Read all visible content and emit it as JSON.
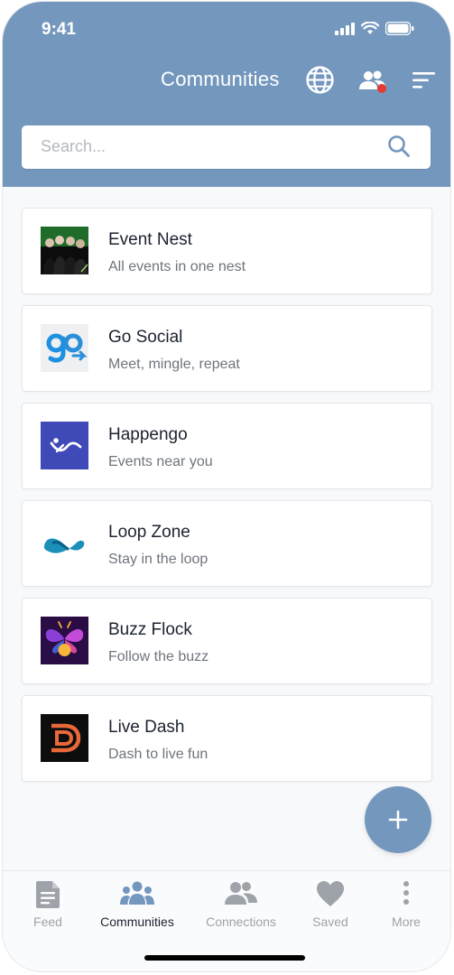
{
  "status": {
    "time": "9:41"
  },
  "header": {
    "title": "Communities"
  },
  "search": {
    "placeholder": "Search..."
  },
  "communities": [
    {
      "title": "Event Nest",
      "subtitle": "All events in one nest",
      "logo": "band-photo-logo"
    },
    {
      "title": "Go Social",
      "subtitle": "Meet, mingle, repeat",
      "logo": "go-logo"
    },
    {
      "title": "Happengo",
      "subtitle": "Events near you",
      "logo": "happengo-logo"
    },
    {
      "title": "Loop Zone",
      "subtitle": "Stay in the loop",
      "logo": "loop-logo"
    },
    {
      "title": "Buzz Flock",
      "subtitle": "Follow the buzz",
      "logo": "firefly-logo"
    },
    {
      "title": "Live Dash",
      "subtitle": "Dash to live fun",
      "logo": "live-dash-logo"
    }
  ],
  "fab": {
    "icon": "plus-icon"
  },
  "nav": [
    {
      "label": "Feed",
      "icon": "document-icon"
    },
    {
      "label": "Communities",
      "icon": "group-icon"
    },
    {
      "label": "Connections",
      "icon": "people-icon"
    },
    {
      "label": "Saved",
      "icon": "heart-icon"
    },
    {
      "label": "More",
      "icon": "more-vertical-icon"
    }
  ],
  "colors": {
    "header": "#7497bd",
    "accent": "#7497bd",
    "notification_dot": "#e53935",
    "active_nav_icon": "#7497bd",
    "inactive_nav_icon": "#9ea3a9"
  }
}
